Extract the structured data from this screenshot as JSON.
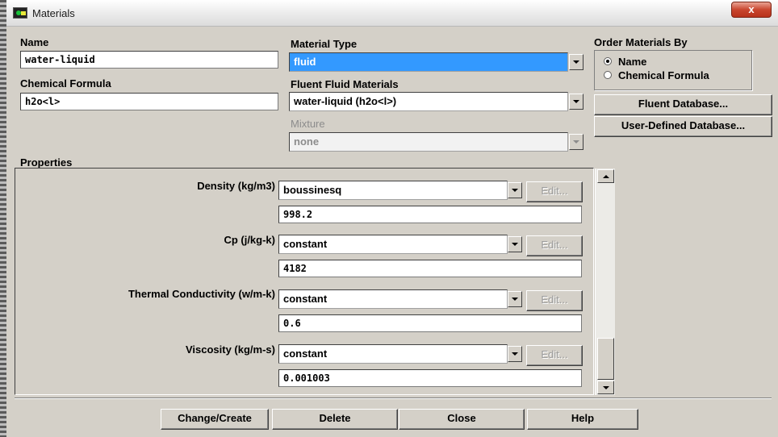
{
  "window": {
    "title": "Materials",
    "close_glyph": "x"
  },
  "name": {
    "label": "Name",
    "value": "water-liquid"
  },
  "chemical_formula": {
    "label": "Chemical Formula",
    "value": "h2o<l>"
  },
  "material_type": {
    "label": "Material Type",
    "value": "fluid"
  },
  "fluent_fluid_materials": {
    "label": "Fluent Fluid Materials",
    "value": "water-liquid (h2o<l>)"
  },
  "mixture": {
    "label": "Mixture",
    "value": "none",
    "enabled": false
  },
  "order_by": {
    "label": "Order Materials By",
    "options": [
      "Name",
      "Chemical Formula"
    ],
    "selected": "Name"
  },
  "database_buttons": {
    "fluent": "Fluent Database...",
    "user_defined": "User-Defined Database..."
  },
  "properties": {
    "label": "Properties",
    "items": [
      {
        "label": "Density (kg/m3)",
        "method": "boussinesq",
        "edit": "Edit...",
        "value": "998.2"
      },
      {
        "label": "Cp (j/kg-k)",
        "method": "constant",
        "edit": "Edit...",
        "value": "4182"
      },
      {
        "label": "Thermal Conductivity (w/m-k)",
        "method": "constant",
        "edit": "Edit...",
        "value": "0.6"
      },
      {
        "label": "Viscosity (kg/m-s)",
        "method": "constant",
        "edit": "Edit...",
        "value": "0.001003"
      }
    ]
  },
  "actions": {
    "change_create": "Change/Create",
    "delete": "Delete",
    "close": "Close",
    "help": "Help"
  },
  "colors": {
    "selection": "#3399ff",
    "dialog_bg": "#d4d0c8"
  },
  "icons": {
    "app": "fluent-app-icon",
    "close": "close-icon"
  }
}
